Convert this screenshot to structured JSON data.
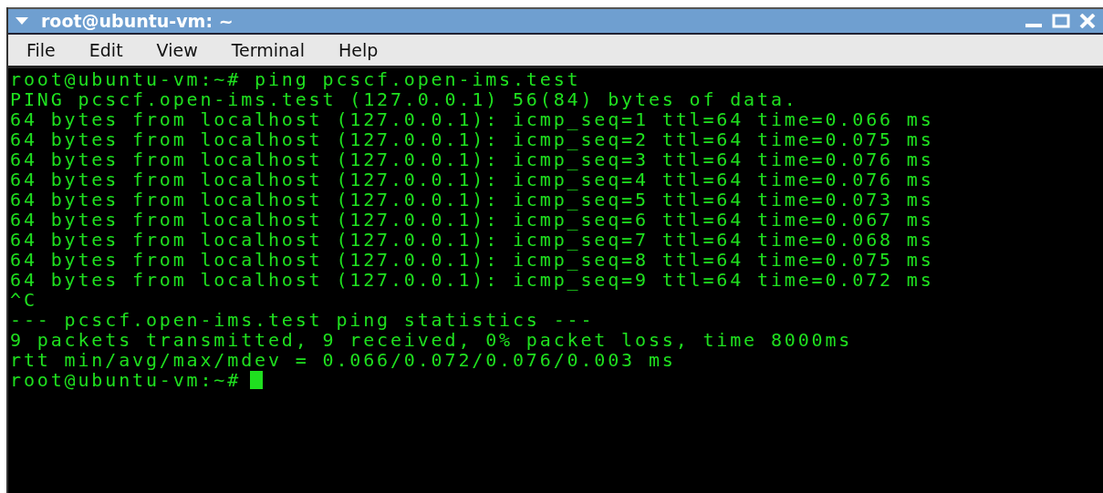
{
  "window": {
    "title": "root@ubuntu-vm: ~"
  },
  "menu": [
    "File",
    "Edit",
    "View",
    "Terminal",
    "Help"
  ],
  "terminal": {
    "lines": [
      "root@ubuntu-vm:~# ping pcscf.open-ims.test",
      "PING pcscf.open-ims.test (127.0.0.1) 56(84) bytes of data.",
      "64 bytes from localhost (127.0.0.1): icmp_seq=1 ttl=64 time=0.066 ms",
      "64 bytes from localhost (127.0.0.1): icmp_seq=2 ttl=64 time=0.075 ms",
      "64 bytes from localhost (127.0.0.1): icmp_seq=3 ttl=64 time=0.076 ms",
      "64 bytes from localhost (127.0.0.1): icmp_seq=4 ttl=64 time=0.076 ms",
      "64 bytes from localhost (127.0.0.1): icmp_seq=5 ttl=64 time=0.073 ms",
      "64 bytes from localhost (127.0.0.1): icmp_seq=6 ttl=64 time=0.067 ms",
      "64 bytes from localhost (127.0.0.1): icmp_seq=7 ttl=64 time=0.068 ms",
      "64 bytes from localhost (127.0.0.1): icmp_seq=8 ttl=64 time=0.075 ms",
      "64 bytes from localhost (127.0.0.1): icmp_seq=9 ttl=64 time=0.072 ms",
      "^C",
      "--- pcscf.open-ims.test ping statistics ---",
      "9 packets transmitted, 9 received, 0% packet loss, time 8000ms",
      "rtt min/avg/max/mdev = 0.066/0.072/0.076/0.003 ms",
      "root@ubuntu-vm:~#"
    ],
    "cursor": true
  }
}
